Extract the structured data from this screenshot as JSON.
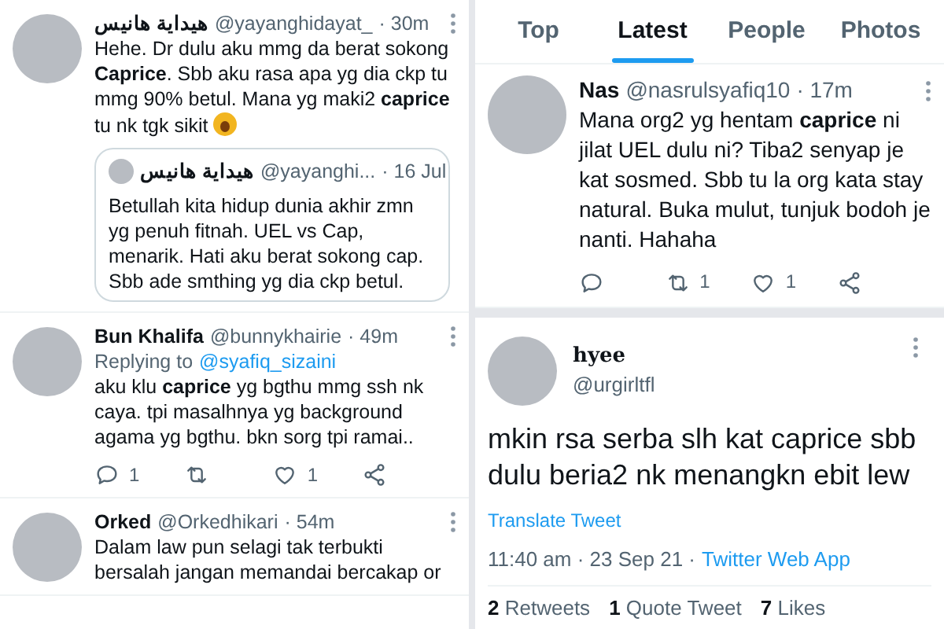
{
  "left_column": {
    "tweets": [
      {
        "display_name": "هيداية هانيس",
        "handle": "@yayanghidayat_",
        "time": "· 30m",
        "text": "Hehe. Dr dulu aku mmg da berat sokong **Caprice**. Sbb aku rasa apa yg dia ckp tu mmg 90% betul. Mana yg maki2 **caprice** tu nk tgk sikit",
        "trailing_emoji": true,
        "quote": {
          "display_name": "هيداية هانيس",
          "handle": "@yayanghi...",
          "time": "· 16 Jul",
          "text": "Betullah kita hidup dunia akhir zmn yg penuh fitnah. UEL vs Cap, menarik. Hati aku berat sokong cap. Sbb ade smthing yg dia ckp betul."
        }
      },
      {
        "display_name": "Bun Khalifa",
        "handle": "@bunnykhairie",
        "time": "· 49m",
        "replying_label": "Replying to",
        "replying_to": "@syafiq_sizaini",
        "text": "aku klu **caprice** yg bgthu mmg ssh nk caya. tpi masalhnya yg background agama yg bgthu. bkn sorg tpi ramai..",
        "actions": [
          {
            "kind": "reply",
            "count": "1"
          },
          {
            "kind": "retweet"
          },
          {
            "kind": "like",
            "count": "1"
          },
          {
            "kind": "share"
          }
        ]
      },
      {
        "display_name": "Orked",
        "handle": "@Orkedhikari",
        "time": "· 54m",
        "text": "Dalam law pun selagi tak terbukti bersalah jangan memandai bercakap or"
      }
    ]
  },
  "right_column": {
    "tabs": [
      {
        "label": "Top",
        "selected": false
      },
      {
        "label": "Latest",
        "selected": true
      },
      {
        "label": "People",
        "selected": false
      },
      {
        "label": "Photos",
        "selected": false
      }
    ],
    "tweets": [
      {
        "display_name": "Nas",
        "handle": "@nasrulsyafiq10",
        "time": "· 17m",
        "text": "Mana org2 yg hentam **caprice** ni jilat UEL dulu ni? Tiba2 senyap je kat sosmed. Sbb tu la org kata stay natural. Buka mulut, tunjuk bodoh je nanti. Hahaha",
        "actions": [
          {
            "kind": "reply"
          },
          {
            "kind": "retweet",
            "count": "1"
          },
          {
            "kind": "like",
            "count": "1"
          },
          {
            "kind": "share"
          }
        ]
      }
    ],
    "detail_tweet": {
      "display_name": "hyee",
      "handle": "@urgirltfl",
      "text": "mkin rsa serba slh kat caprice sbb dulu beria2 nk menangkn ebit lew",
      "translate": "Translate Tweet",
      "timestamp": "11:40 am · 23 Sep 21 ·",
      "source": "Twitter Web App",
      "stats": [
        {
          "count": "2",
          "label": "Retweets"
        },
        {
          "count": "1",
          "label": "Quote Tweet"
        },
        {
          "count": "7",
          "label": "Likes"
        }
      ]
    }
  }
}
